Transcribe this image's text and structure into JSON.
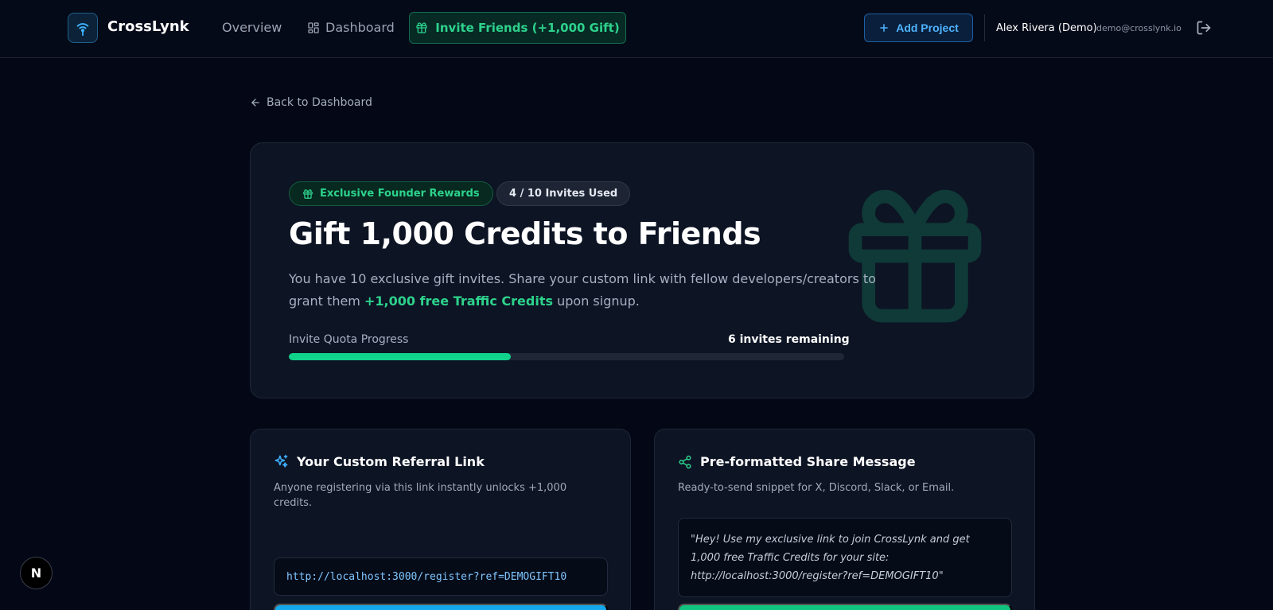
{
  "header": {
    "brand": "CrossLynk",
    "nav": {
      "overview": "Overview",
      "dashboard": "Dashboard",
      "invite": "Invite Friends (+1,000 Gift)"
    },
    "add_project": "Add Project",
    "user_name": "Alex Rivera (Demo)",
    "user_email": "demo@crosslynk.io"
  },
  "back_link": "Back to Dashboard",
  "hero": {
    "badge_rewards": "Exclusive Founder Rewards",
    "badge_invites": "4 / 10 Invites Used",
    "title": "Gift 1,000 Credits to Friends",
    "desc_before": "You have 10 exclusive gift invites. Share your custom link with fellow developers/creators to grant them ",
    "desc_highlight": "+1,000 free Traffic Credits",
    "desc_after": " upon signup.",
    "quota_label": "Invite Quota Progress",
    "quota_remaining": "6 invites remaining",
    "quota_used_fraction": 0.4
  },
  "referral_card": {
    "title": "Your Custom Referral Link",
    "subtitle": "Anyone registering via this link instantly unlocks +1,000 credits.",
    "link": "http://localhost:3000/register?ref=DEMOGIFT10"
  },
  "share_card": {
    "title": "Pre-formatted Share Message",
    "subtitle": "Ready-to-send snippet for X, Discord, Slack, or Email.",
    "message": "\"Hey! Use my exclusive link to join CrossLynk and get 1,000 free Traffic Credits for your site: http://localhost:3000/register?ref=DEMOGIFT10\""
  },
  "dev_badge": "N",
  "colors": {
    "background": "#040816",
    "accent_green": "#2dd28c",
    "accent_blue": "#4fb3ff",
    "progress_fill": "#10d38b"
  },
  "icons": [
    "wifi-antenna-icon",
    "grid-icon",
    "gift-icon",
    "plus-icon",
    "logout-icon",
    "arrow-left-icon",
    "sparkles-icon",
    "share-icon"
  ]
}
